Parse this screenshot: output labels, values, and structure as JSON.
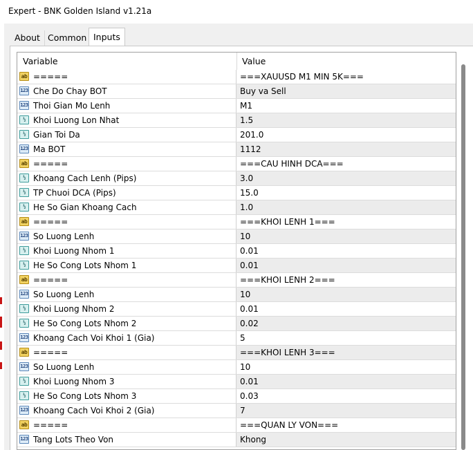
{
  "window": {
    "title": "Expert - BNK Golden Island v1.21a"
  },
  "tabs": [
    {
      "label": "About",
      "active": false
    },
    {
      "label": "Common",
      "active": false
    },
    {
      "label": "Inputs",
      "active": true
    }
  ],
  "grid": {
    "columns": {
      "variable": "Variable",
      "value": "Value"
    },
    "rows": [
      {
        "icon": "string-icon",
        "variable": "=====",
        "value": "===XAUUSD M1 MIN 5K==="
      },
      {
        "icon": "integer-icon",
        "variable": "Che Do Chay BOT",
        "value": "Buy va Sell"
      },
      {
        "icon": "integer-icon",
        "variable": "Thoi Gian Mo Lenh",
        "value": "M1"
      },
      {
        "icon": "double-icon",
        "variable": "Khoi Luong Lon Nhat",
        "value": "1.5"
      },
      {
        "icon": "double-icon",
        "variable": "Gian Toi Da",
        "value": "201.0"
      },
      {
        "icon": "integer-icon",
        "variable": "Ma BOT",
        "value": "1112"
      },
      {
        "icon": "string-icon",
        "variable": "=====",
        "value": "===CAU HINH DCA==="
      },
      {
        "icon": "double-icon",
        "variable": "Khoang Cach Lenh (Pips)",
        "value": "3.0"
      },
      {
        "icon": "double-icon",
        "variable": "TP Chuoi DCA (Pips)",
        "value": "15.0"
      },
      {
        "icon": "double-icon",
        "variable": "He So Gian Khoang Cach",
        "value": "1.0"
      },
      {
        "icon": "string-icon",
        "variable": "=====",
        "value": "===KHOI LENH 1==="
      },
      {
        "icon": "integer-icon",
        "variable": "So Luong Lenh",
        "value": "10"
      },
      {
        "icon": "double-icon",
        "variable": "Khoi Luong Nhom 1",
        "value": "0.01"
      },
      {
        "icon": "double-icon",
        "variable": "He So Cong Lots Nhom 1",
        "value": "0.01"
      },
      {
        "icon": "string-icon",
        "variable": "=====",
        "value": "===KHOI LENH 2==="
      },
      {
        "icon": "integer-icon",
        "variable": "So Luong Lenh",
        "value": "10"
      },
      {
        "icon": "double-icon",
        "variable": "Khoi Luong Nhom 2",
        "value": "0.01"
      },
      {
        "icon": "double-icon",
        "variable": "He So Cong Lots Nhom 2",
        "value": "0.02"
      },
      {
        "icon": "integer-icon",
        "variable": "Khoang Cach Voi Khoi 1 (Gia)",
        "value": "5"
      },
      {
        "icon": "string-icon",
        "variable": "=====",
        "value": "===KHOI LENH 3==="
      },
      {
        "icon": "integer-icon",
        "variable": "So Luong Lenh",
        "value": "10"
      },
      {
        "icon": "double-icon",
        "variable": "Khoi Luong Nhom 3",
        "value": "0.01"
      },
      {
        "icon": "double-icon",
        "variable": "He So Cong Lots Nhom 3",
        "value": "0.03"
      },
      {
        "icon": "integer-icon",
        "variable": "Khoang Cach Voi Khoi 2 (Gia)",
        "value": "7"
      },
      {
        "icon": "string-icon",
        "variable": "=====",
        "value": "===QUAN LY VON==="
      },
      {
        "icon": "integer-icon",
        "variable": "Tang Lots Theo Von",
        "value": "Khong"
      }
    ]
  },
  "icon_glyphs": {
    "string-icon": "ab",
    "integer-icon": "123",
    "double-icon": "½"
  },
  "colors": {
    "string_icon": "#f1d262",
    "integer_icon": "#dcebf7",
    "double_icon": "#d7f0ef",
    "alt_row": "#ececec"
  }
}
